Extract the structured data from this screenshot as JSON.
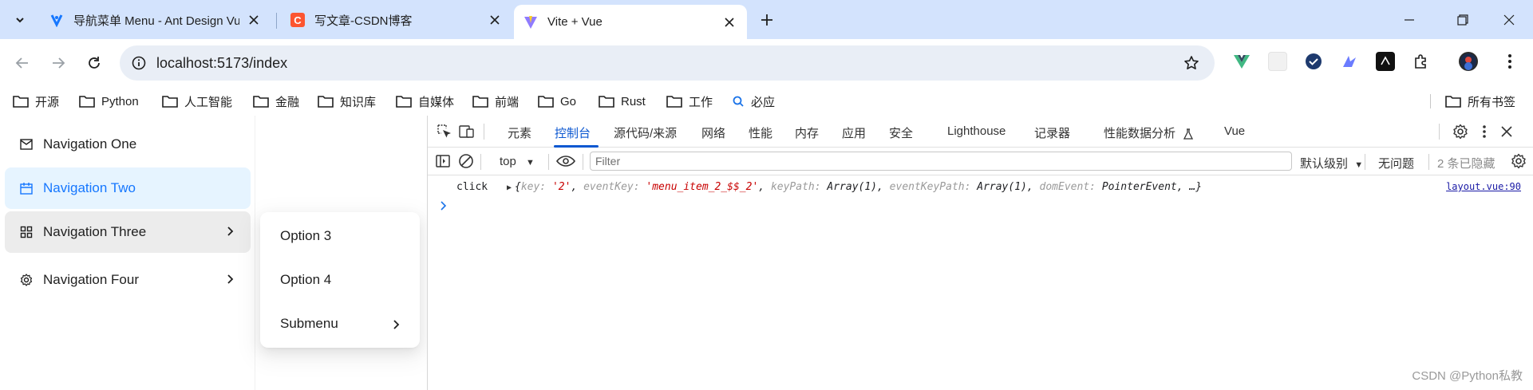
{
  "browser": {
    "tabs": [
      {
        "title": "导航菜单 Menu - Ant Design Vue",
        "active": false
      },
      {
        "title": "写文章-CSDN博客",
        "active": false
      },
      {
        "title": "Vite + Vue",
        "active": true
      }
    ],
    "url": "localhost:5173/index",
    "bookmarks": [
      "开源",
      "Python",
      "人工智能",
      "金融",
      "知识库",
      "自媒体",
      "前端",
      "Go",
      "Rust",
      "工作",
      "必应"
    ],
    "all_bookmarks_label": "所有书签"
  },
  "menu": {
    "items": [
      {
        "label": "Navigation One",
        "icon": "mail-icon",
        "state": "normal"
      },
      {
        "label": "Navigation Two",
        "icon": "calendar-icon",
        "state": "selected"
      },
      {
        "label": "Navigation Three",
        "icon": "appstore-icon",
        "state": "open"
      },
      {
        "label": "Navigation Four",
        "icon": "setting-icon",
        "state": "normal"
      }
    ],
    "popup": [
      "Option 3",
      "Option 4",
      "Submenu"
    ]
  },
  "devtools": {
    "tabs": [
      "元素",
      "控制台",
      "源代码/来源",
      "网络",
      "性能",
      "内存",
      "应用",
      "安全",
      "Lighthouse",
      "记录器",
      "性能数据分析",
      "Vue"
    ],
    "active_tab": "控制台",
    "context": "top",
    "filter_placeholder": "Filter",
    "level_label": "默认级别",
    "issues_label": "无问题",
    "hidden_label": "2 条已隐藏",
    "log": {
      "prefix": "click",
      "key_label": "key:",
      "key_value": "'2'",
      "eventkey_label": "eventKey:",
      "eventkey_value": "'menu_item_2_$$_2'",
      "keypath_label": "keyPath:",
      "keypath_value": "Array(1)",
      "eventkeypath_label": "eventKeyPath:",
      "eventkeypath_value": "Array(1)",
      "domevent_label": "domEvent:",
      "domevent_value": "PointerEvent",
      "ellipsis": "…}",
      "source": "layout.vue:90"
    }
  },
  "watermark": "CSDN @Python私教",
  "colors": {
    "accent": "#1677ff",
    "selected_bg": "#e6f4ff",
    "chrome_tabstrip": "#d3e3fd",
    "string": "#c80000"
  }
}
